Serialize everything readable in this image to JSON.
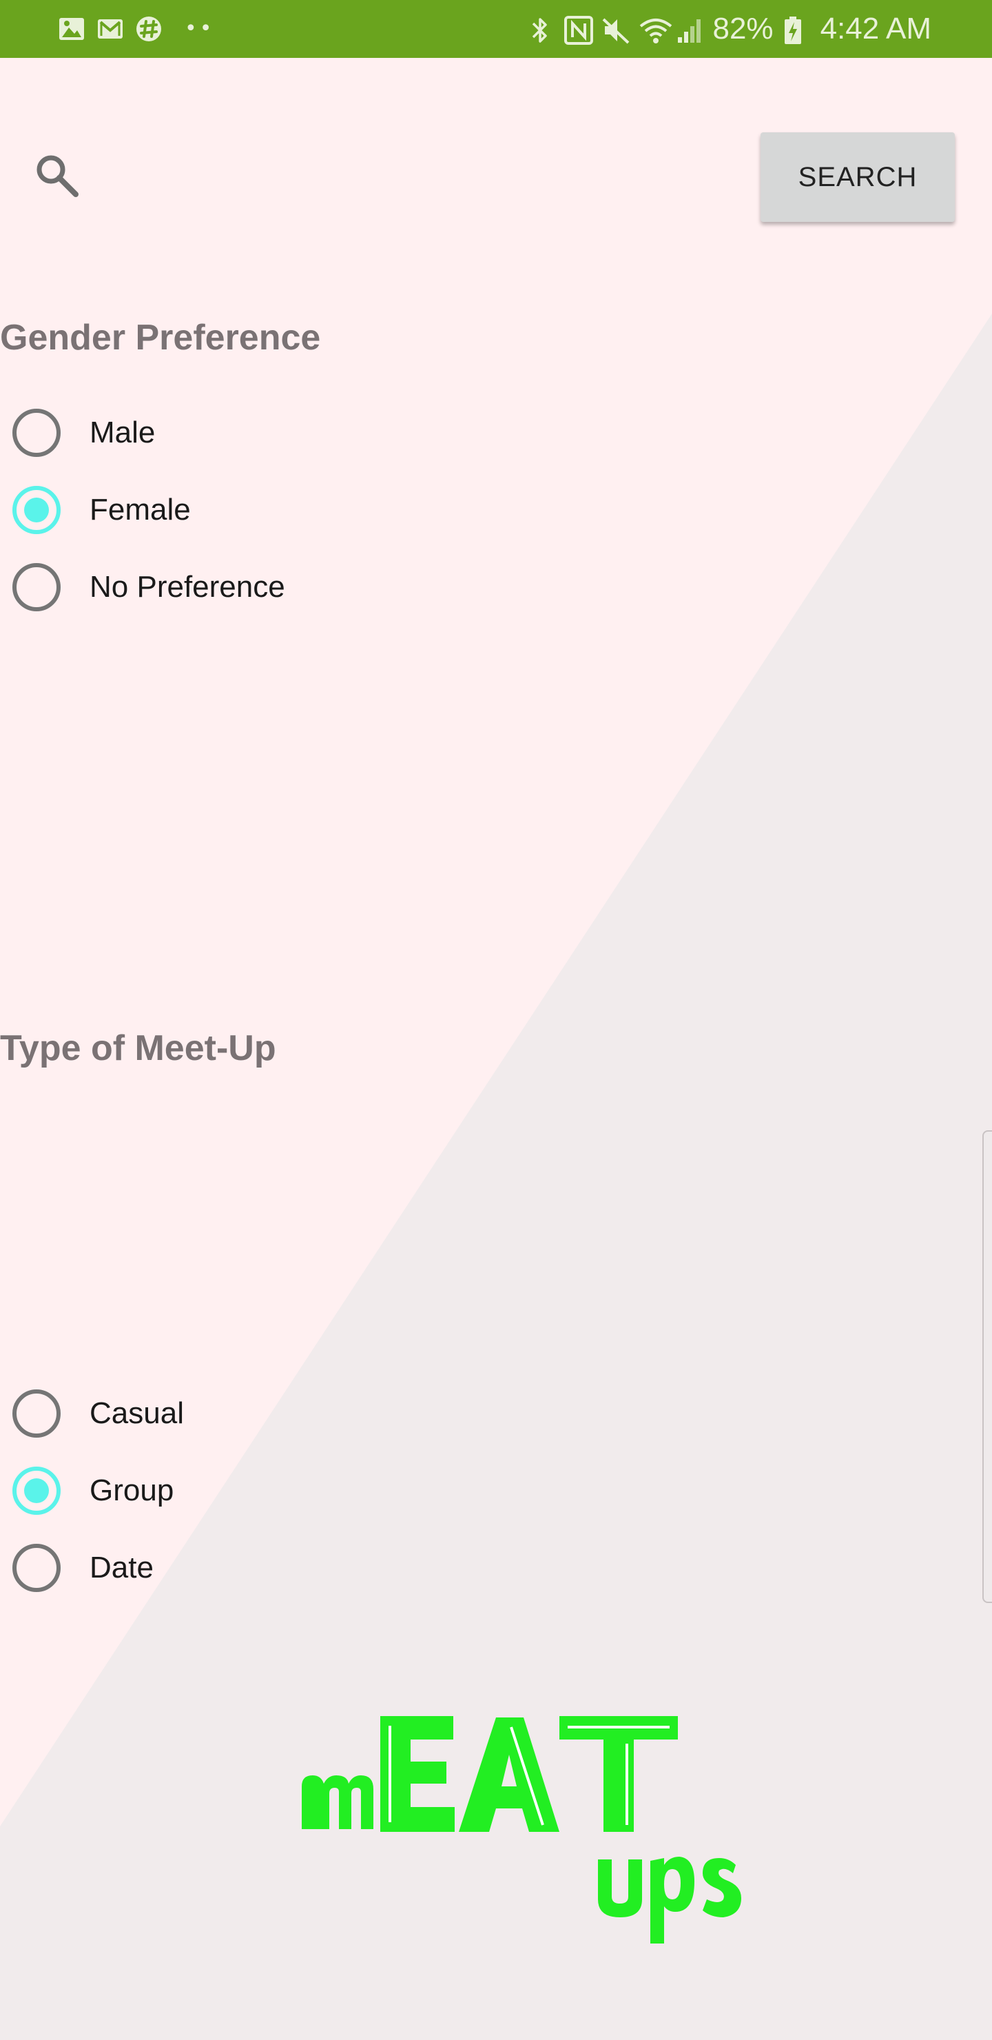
{
  "status_bar": {
    "battery": "82%",
    "time": "4:42 AM",
    "overflow_dots": "••",
    "left_icons": [
      "gallery-icon",
      "gmail-icon",
      "slack-icon"
    ],
    "right_icons": [
      "bluetooth-icon",
      "nfc-icon",
      "mute-icon",
      "wifi-icon",
      "signal-icon",
      "battery-charging-icon"
    ],
    "color": "#6aa41e"
  },
  "search": {
    "button_label": "SEARCH"
  },
  "gender_preference": {
    "title": "Gender Preference",
    "options": [
      {
        "label": "Male",
        "checked": false
      },
      {
        "label": "Female",
        "checked": true
      },
      {
        "label": "No Preference",
        "checked": false
      }
    ]
  },
  "meetup_type": {
    "title": "Type of Meet-Up",
    "options": [
      {
        "label": "Casual",
        "checked": false
      },
      {
        "label": "Group",
        "checked": true
      },
      {
        "label": "Date",
        "checked": false
      }
    ]
  },
  "logo": {
    "text_main": "mEAT",
    "text_sub": "ups",
    "color": "#22ee22"
  },
  "colors": {
    "accent": "#5af3ea",
    "background_light": "#fff0f1",
    "background_dark": "#f1ebec"
  }
}
